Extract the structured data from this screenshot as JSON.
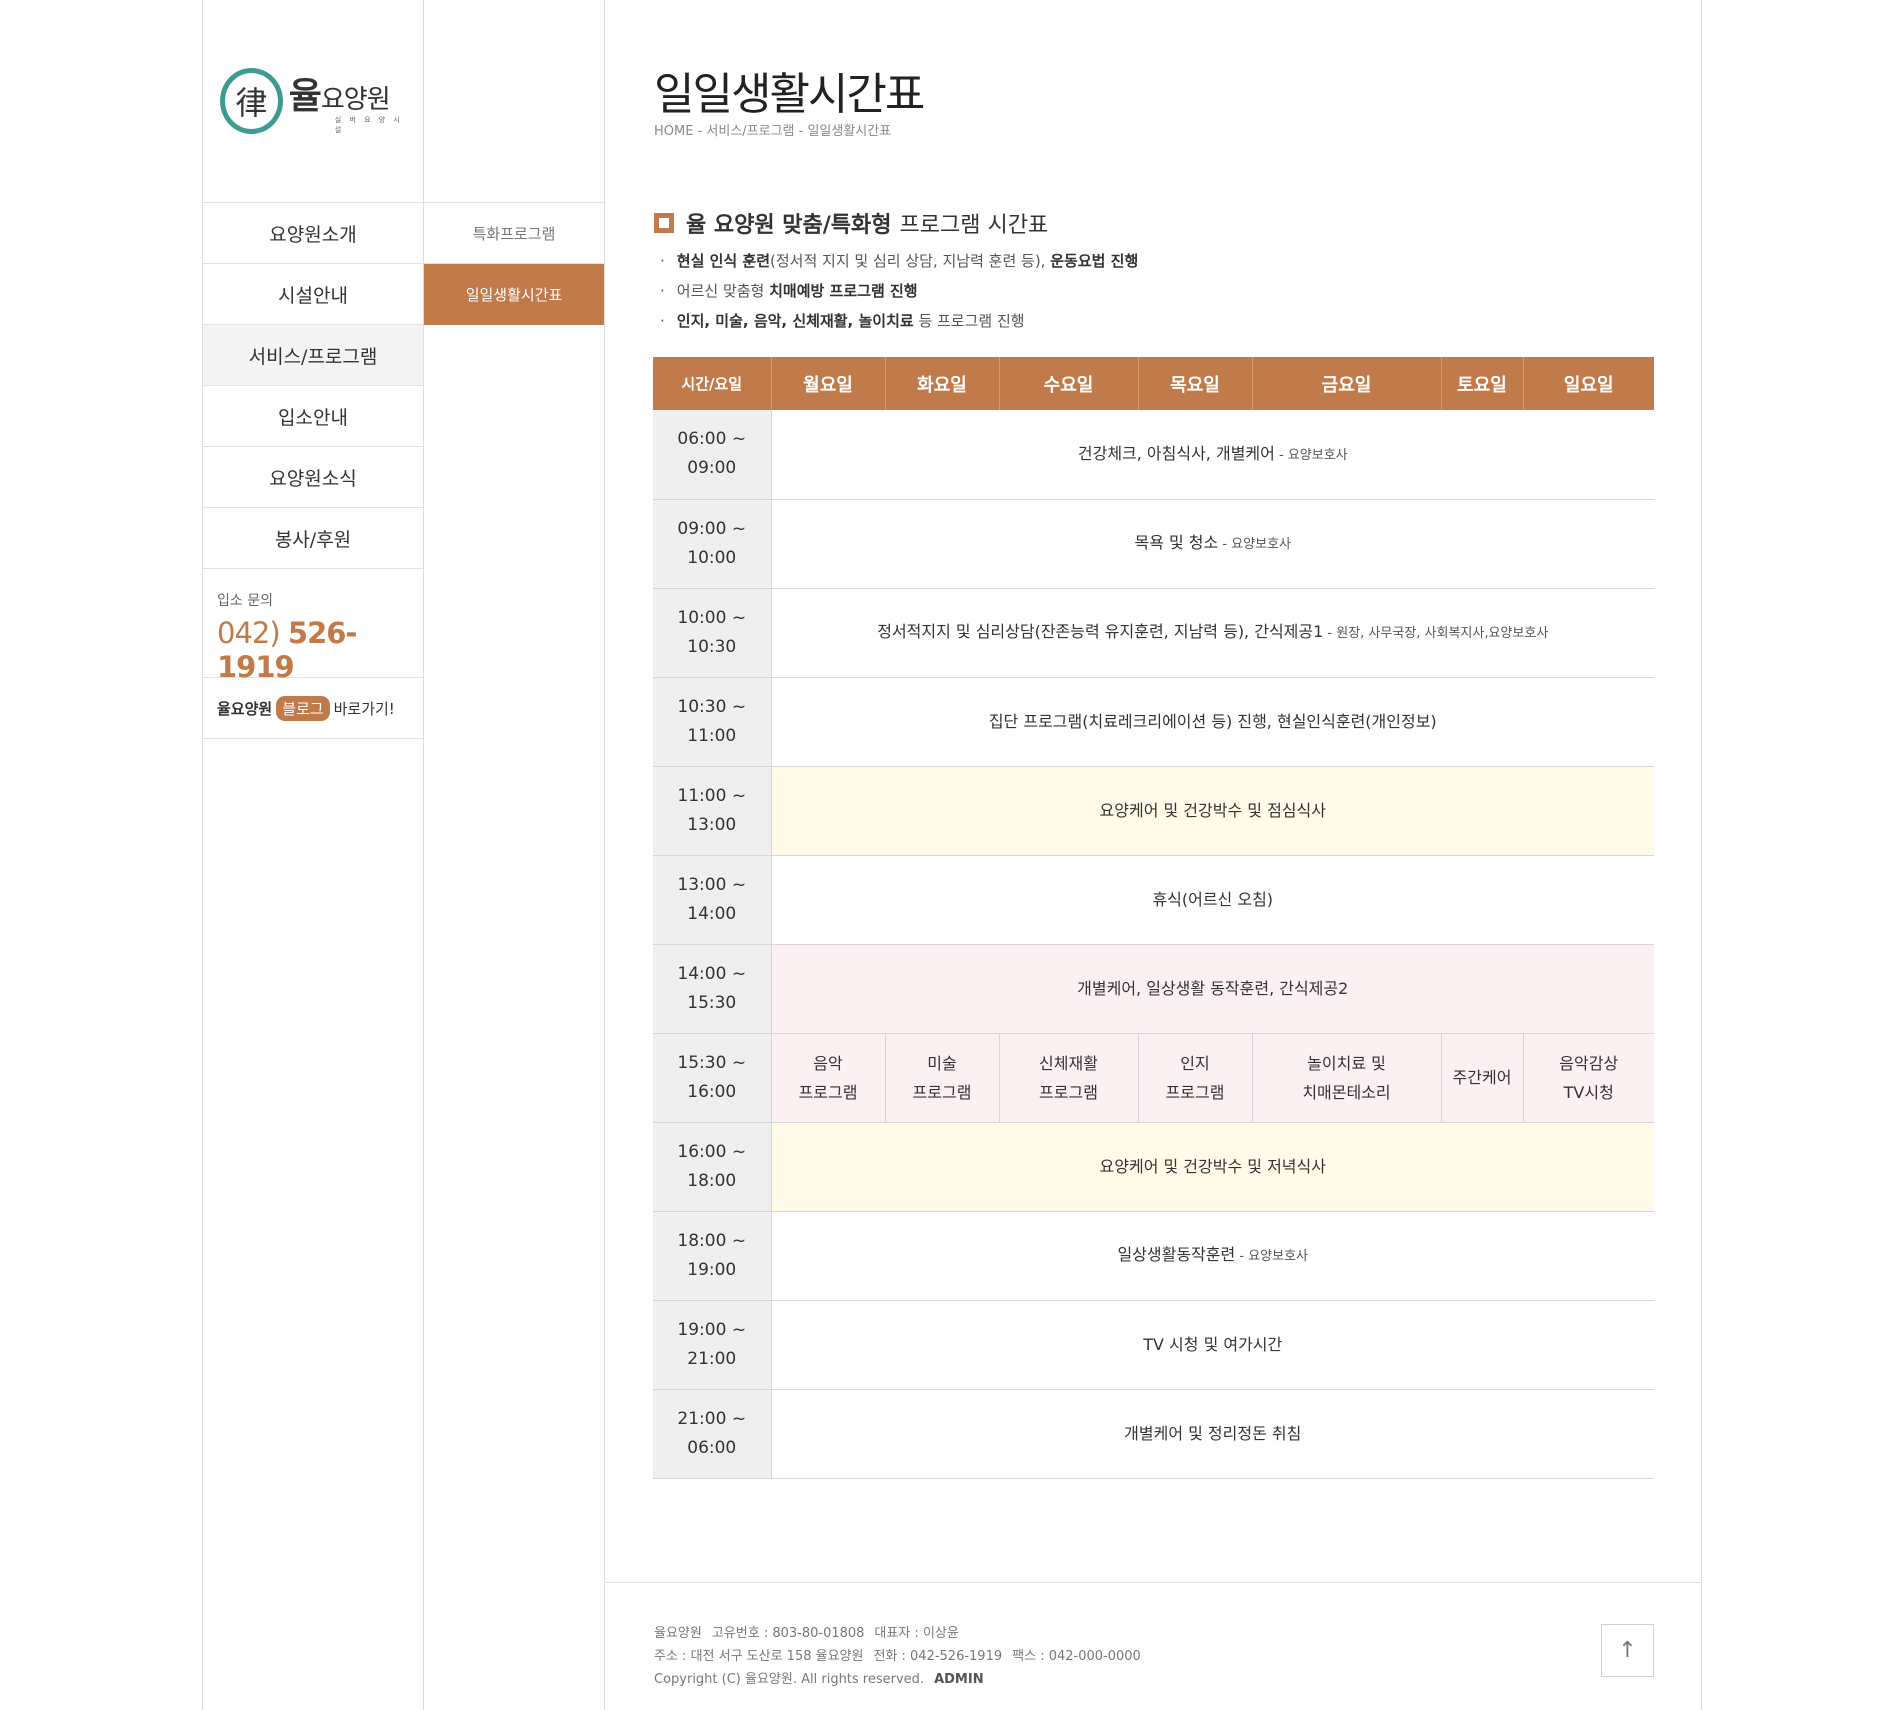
{
  "logo": {
    "hanja": "律",
    "main_bold": "율",
    "main": "요양원",
    "sub": "실 버 요 양 시 설"
  },
  "nav": {
    "items": [
      "요양원소개",
      "시설안내",
      "서비스/프로그램",
      "입소안내",
      "요양원소식",
      "봉사/후원"
    ]
  },
  "contact": {
    "label": "입소 문의",
    "area": "042)",
    "number": "526-1919"
  },
  "blog": {
    "name": "율요양원",
    "badge": "블로그",
    "suffix": "바로가기!"
  },
  "subnav": {
    "items": [
      "특화프로그램",
      "일일생활시간표"
    ]
  },
  "page": {
    "title": "일일생활시간표",
    "breadcrumb": "HOME - 서비스/프로그램 - 일일생활시간표"
  },
  "section": {
    "title_bold": "율 요양원 맞춤/특화형",
    "title_rest": "프로그램 시간표"
  },
  "bullets": [
    {
      "b1": "현실 인식 훈련",
      "t1": "(정서적 지지 및 심리 상담, 지남력 훈련 등), ",
      "b2": "운동요법 진행"
    },
    {
      "b1": "",
      "t1": "어르신 맞춤형 ",
      "b2": "치매예방 프로그램 진행"
    },
    {
      "b1": "인지, 미술, 음악, 신체재활, 놀이치료",
      "t1": " 등 프로그램 진행",
      "b2": ""
    }
  ],
  "schedule": {
    "headers": [
      "시간/요일",
      "월요일",
      "화요일",
      "수요일",
      "목요일",
      "금요일",
      "토요일",
      "일요일"
    ],
    "rows": [
      {
        "t1": "06:00 ~",
        "t2": "09:00",
        "text": "건강체크, 아침식사, 개별케어",
        "staff": " - 요양보호사"
      },
      {
        "t1": "09:00 ~",
        "t2": "10:00",
        "text": "목욕 및 청소",
        "staff": " - 요양보호사"
      },
      {
        "t1": "10:00 ~",
        "t2": "10:30",
        "text": "정서적지지 및 심리상담(잔존능력 유지훈련, 지남력 등), 간식제공1",
        "staff": " - 원장, 사무국장, 사회복지사,요양보호사"
      },
      {
        "t1": "10:30 ~",
        "t2": "11:00",
        "text": "집단 프로그램(치료레크리에이션 등) 진행, 현실인식훈련(개인정보)",
        "staff": ""
      },
      {
        "t1": "11:00 ~",
        "t2": "13:00",
        "text": "요양케어 및 건강박수 및 점심식사",
        "staff": ""
      },
      {
        "t1": "13:00 ~",
        "t2": "14:00",
        "text": "휴식(어르신 오침)",
        "staff": ""
      },
      {
        "t1": "14:00 ~",
        "t2": "15:30",
        "text": "개별케어, 일상생활 동작훈련, 간식제공2",
        "staff": ""
      },
      {
        "t1": "15:30 ~",
        "t2": "16:00",
        "programs": [
          [
            "음악",
            "프로그램"
          ],
          [
            "미술",
            "프로그램"
          ],
          [
            "신체재활",
            "프로그램"
          ],
          [
            "인지",
            "프로그램"
          ],
          [
            "놀이치료 및",
            "치매몬테소리"
          ],
          [
            "주간케어",
            ""
          ],
          [
            "음악감상",
            "TV시청"
          ]
        ]
      },
      {
        "t1": "16:00 ~",
        "t2": "18:00",
        "text": "요양케어 및 건강박수 및 저녁식사",
        "staff": ""
      },
      {
        "t1": "18:00 ~",
        "t2": "19:00",
        "text": "일상생활동작훈련",
        "staff": " - 요양보호사"
      },
      {
        "t1": "19:00 ~",
        "t2": "21:00",
        "text": "TV 시청 및 여가시간",
        "staff": ""
      },
      {
        "t1": "21:00 ~",
        "t2": "06:00",
        "text": "개별케어 및 정리정돈 취침",
        "staff": ""
      }
    ]
  },
  "colors": {
    "accent": "#c17b4a",
    "meal_row": "#fffbe8",
    "care_row": "#fdf0f2",
    "time_col": "#efefef"
  },
  "footer": {
    "line1": [
      "율요양원",
      "고유번호 : 803-80-01808",
      "대표자 : 이상윤"
    ],
    "line2": [
      "주소 : 대전 서구 도산로 158 율요양원",
      "전화 : 042-526-1919",
      "팩스 : 042-000-0000"
    ],
    "copyright": "Copyright (C) 율요양원. All rights reserved.",
    "admin": "ADMIN",
    "top_icon": "arrow-up-icon",
    "top_glyph": "↑"
  }
}
